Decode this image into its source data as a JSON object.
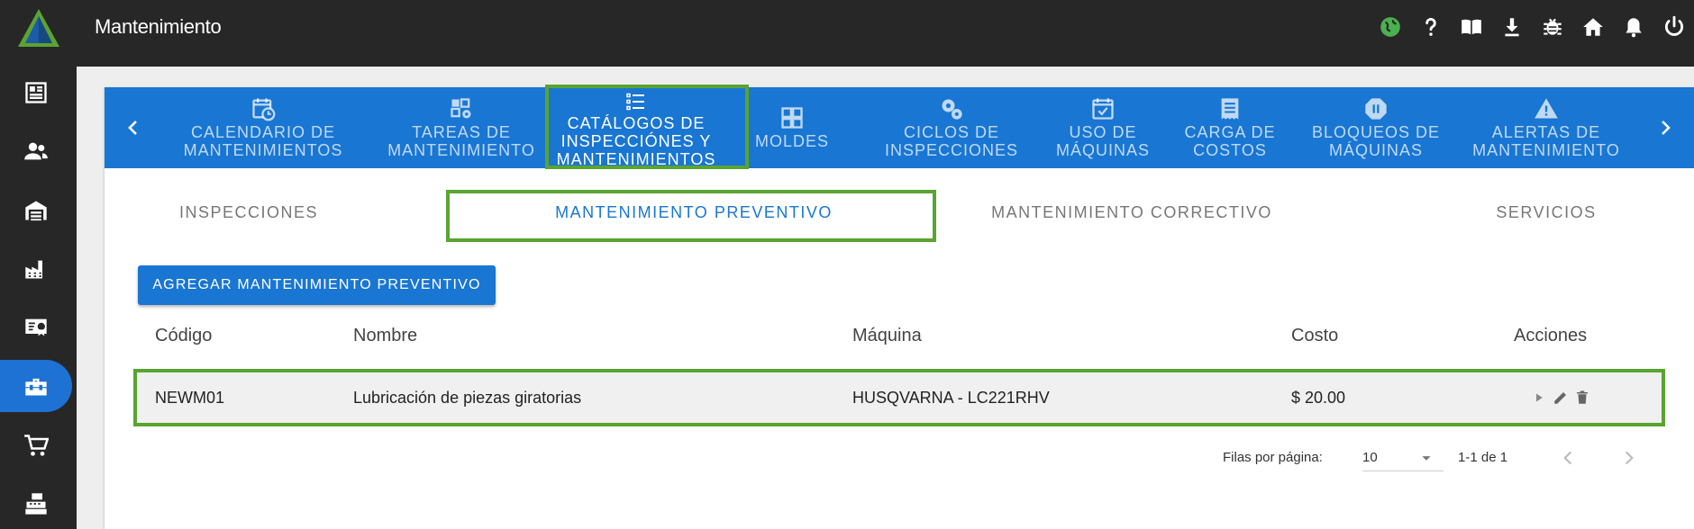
{
  "app": {
    "title": "Mantenimiento"
  },
  "top_icons": [
    "globe-icon",
    "help-icon",
    "book-icon",
    "download-icon",
    "bug-icon",
    "home-icon",
    "bell-icon",
    "power-icon"
  ],
  "sidebar": {
    "items": [
      {
        "icon": "news-icon",
        "active": false
      },
      {
        "icon": "people-icon",
        "active": false
      },
      {
        "icon": "warehouse-icon",
        "active": false
      },
      {
        "icon": "factory-icon",
        "active": false
      },
      {
        "icon": "certificate-icon",
        "active": false
      },
      {
        "icon": "toolbox-icon",
        "active": true
      },
      {
        "icon": "cart-icon",
        "active": false
      },
      {
        "icon": "register-icon",
        "active": false
      }
    ]
  },
  "main_tabs": [
    {
      "label": "CALENDARIO DE\nMANTENIMIENTOS",
      "icon": "calendar-clock-icon"
    },
    {
      "label": "TAREAS DE\nMANTENIMIENTO",
      "icon": "tasks-gear-icon"
    },
    {
      "label": "CATÁLOGOS DE\nINSPECCIÓNES Y\nMANTENIMIENTOS",
      "icon": "list-icon",
      "active": true
    },
    {
      "label": "MOLDES",
      "icon": "grid-icon"
    },
    {
      "label": "CICLOS DE\nINSPECCIONES",
      "icon": "gears-icon"
    },
    {
      "label": "USO DE\nMÁQUINAS",
      "icon": "calendar-check-icon"
    },
    {
      "label": "CARGA DE\nCOSTOS",
      "icon": "receipt-icon"
    },
    {
      "label": "BLOQUEOS DE\nMÁQUINAS",
      "icon": "pause-icon"
    },
    {
      "label": "ALERTAS DE\nMANTENIMIENTO",
      "icon": "alert-icon"
    }
  ],
  "sub_tabs": [
    {
      "label": "INSPECCIONES"
    },
    {
      "label": "MANTENIMIENTO PREVENTIVO",
      "active": true
    },
    {
      "label": "MANTENIMIENTO CORRECTIVO"
    },
    {
      "label": "SERVICIOS"
    }
  ],
  "add_button": "AGREGAR MANTENIMIENTO PREVENTIVO",
  "table": {
    "headers": [
      "Código",
      "Nombre",
      "Máquina",
      "Costo",
      "Acciones"
    ],
    "rows": [
      {
        "codigo": "NEWM01",
        "nombre": "Lubricación de piezas giratorias",
        "maquina": "HUSQVARNA - LC221RHV",
        "costo": "$ 20.00"
      }
    ]
  },
  "pagination": {
    "rows_label": "Filas por página:",
    "rows_value": "10",
    "range": "1-1 de 1"
  },
  "colors": {
    "primary": "#1976d2",
    "highlight": "#5aa431",
    "topbar": "#272727"
  }
}
